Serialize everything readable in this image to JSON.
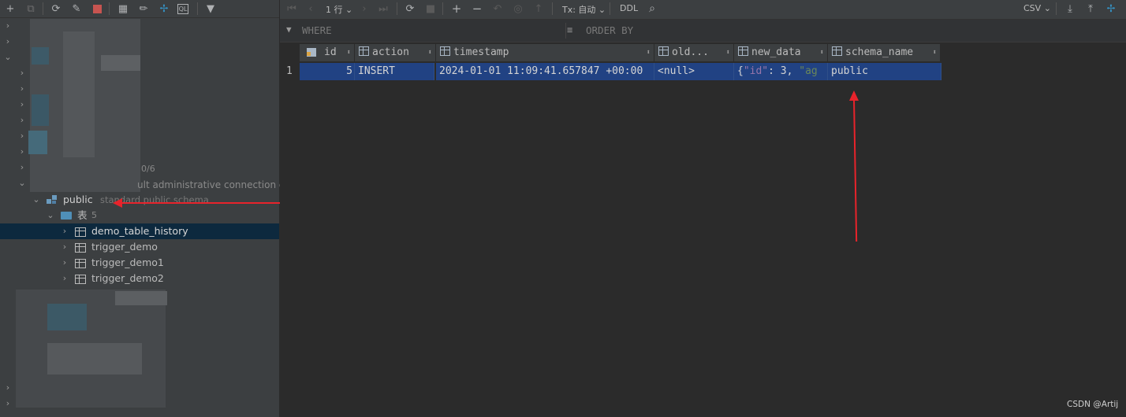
{
  "left_toolbar": {
    "icons": [
      "add-icon",
      "copy-icon",
      "refresh-icon",
      "settings-icon",
      "stop-icon",
      "table-icon",
      "edit-icon",
      "jump-icon",
      "sql-console-icon",
      "filter-icon"
    ]
  },
  "tree": {
    "obscured_badge": "0/6",
    "obscured_comment": "ult administrative connection datal",
    "schema": {
      "name": "public",
      "comment": "standard public schema"
    },
    "tables_folder": {
      "label": "表",
      "count": "5"
    },
    "tables": [
      "demo_table_history",
      "trigger_demo",
      "trigger_demo1",
      "trigger_demo2"
    ],
    "selected_table": "demo_table_history"
  },
  "grid_toolbar": {
    "rows_label": "1 行",
    "tx_label": "Tx: 自动",
    "ddl_label": "DDL",
    "export_format": "CSV"
  },
  "filter_bar": {
    "where_placeholder": "WHERE",
    "order_placeholder": "ORDER BY"
  },
  "grid": {
    "columns": [
      "id",
      "action",
      "timestamp",
      "old...",
      "new_data",
      "schema_name"
    ],
    "rows": [
      {
        "row_number": "1",
        "id": "5",
        "action": "INSERT",
        "timestamp": "2024-01-01 11:09:41.657847 +00:00",
        "old_data": "<null>",
        "new_data_brace": "{",
        "new_data_key": "\"id\"",
        "new_data_rest": ": 3, ",
        "new_data_tail": "\"ag",
        "schema_name": "public"
      }
    ]
  },
  "watermark": "CSDN @Artij",
  "colors": {
    "selection": "#214283",
    "tree_selection": "#0d293e",
    "annotation": "#e8232b"
  }
}
